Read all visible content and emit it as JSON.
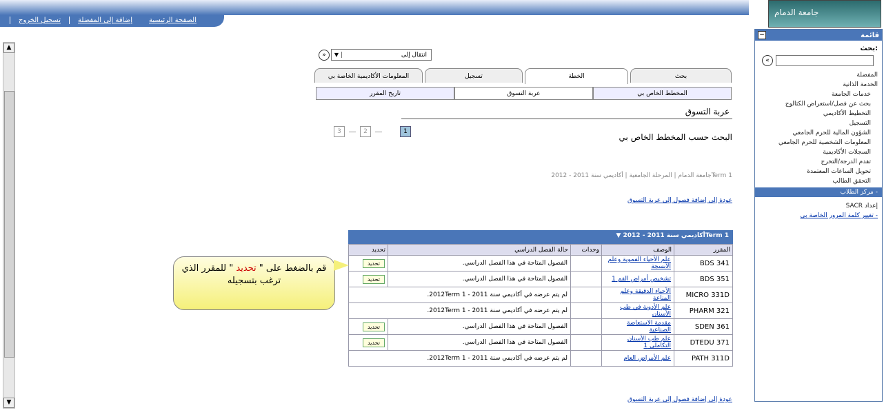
{
  "top_links": [
    "الصفحة الرئيسية",
    "إضافة إلى المفضلة",
    "تسجيل الخروج"
  ],
  "logo_text": "جامعة الدمام",
  "jump": {
    "select_value": "انتقال إلى"
  },
  "tabs": [
    "بحث",
    "الخطة",
    "تسجيل",
    "المعلومات الأكاديمية الخاصة بي"
  ],
  "subtabs": [
    "المخطط الخاص بي",
    "عربة التسوق",
    "تاريخ المقرر"
  ],
  "page_title": "عربة التسوق",
  "pager": [
    "1",
    "2",
    "3"
  ],
  "search_title": "البحث حسب المخطط الخاص بي",
  "breadcrumb": "جامعة الدمام | المرحلة الجامعية | أكاديمي سنة 2011 - 2012Term 1",
  "back_link": "عودة إلى إضافة فصول إلى عربة التسوق",
  "grid": {
    "caption": "أكاديمي سنة 2011 - 2012Term 1",
    "headers": [
      "المقرر",
      "الوصف",
      "وحدات",
      "حالة الفصل الدراسي",
      "تحديد"
    ],
    "rows": [
      {
        "course": "BDS 341",
        "desc": "علم الأحياء الفموية وعلم الأنسجة",
        "units": "",
        "status": "الفصول المتاحة في هذا الفصل الدراسي.",
        "select": "تحديد"
      },
      {
        "course": "BDS 351",
        "desc": "تشخيص أمراض الفم 1",
        "units": "",
        "status": "الفصول المتاحة في هذا الفصل الدراسي.",
        "select": "تحديد"
      },
      {
        "course": "MICRO 331D",
        "desc": "الأحياء الدقيقة وعلم المناعة",
        "units": "",
        "status": "لم يتم عرضه في أكاديمي سنة 2011 - 2012Term 1.",
        "select": ""
      },
      {
        "course": "PHARM 321",
        "desc": "علم الأدوية في طب الأسنان",
        "units": "",
        "status": "لم يتم عرضه في أكاديمي سنة 2011 - 2012Term 1.",
        "select": ""
      },
      {
        "course": "SDEN 361",
        "desc": "مقدمة الاستعاضة الصناعية",
        "units": "",
        "status": "الفصول المتاحة في هذا الفصل الدراسي.",
        "select": "تحديد"
      },
      {
        "course": "DTEDU 371",
        "desc": "علم طب الأسنان التكاملي 1",
        "units": "",
        "status": "الفصول المتاحة في هذا الفصل الدراسي.",
        "select": "تحديد"
      },
      {
        "course": "PATH 311D",
        "desc": "علم الأمراض العام",
        "units": "",
        "status": "لم يتم عرضه في أكاديمي سنة 2011 - 2012Term 1.",
        "select": ""
      }
    ]
  },
  "callout": {
    "pre": "قم بالضغط على \" ",
    "highlight": "تحديد",
    "post": " \" للمقرر الذي ترغب بتسجيله"
  },
  "menu": {
    "title": "قائمة",
    "search_label": "بحث:",
    "items": [
      {
        "label": "المفضلة",
        "kind": "top"
      },
      {
        "label": "الخدمة الذاتية",
        "kind": "top"
      },
      {
        "label": "خدمات الجامعة",
        "kind": "sub"
      },
      {
        "label": "بحث عن فصل/استعراض الكتالوج",
        "kind": "sub"
      },
      {
        "label": "التخطيط الأكاديمي",
        "kind": "sub"
      },
      {
        "label": "التسجيل",
        "kind": "sub"
      },
      {
        "label": "الشؤون المالية للحرم الجامعي",
        "kind": "sub"
      },
      {
        "label": "المعلومات الشخصية للحرم الجامعي",
        "kind": "sub"
      },
      {
        "label": "السجلات الأكاديمية",
        "kind": "sub"
      },
      {
        "label": "تقدم الدرجة/التخرج",
        "kind": "sub"
      },
      {
        "label": "تحويل الساعات المعتمدة",
        "kind": "sub"
      },
      {
        "label": "التحقق الطالب",
        "kind": "sub"
      },
      {
        "label": "- مركز الطلاب",
        "kind": "hl"
      },
      {
        "label": "إعداد SACR",
        "kind": "top"
      },
      {
        "label": "- تغيير كلمة المرور الخاصة بي",
        "kind": "lk"
      }
    ]
  }
}
